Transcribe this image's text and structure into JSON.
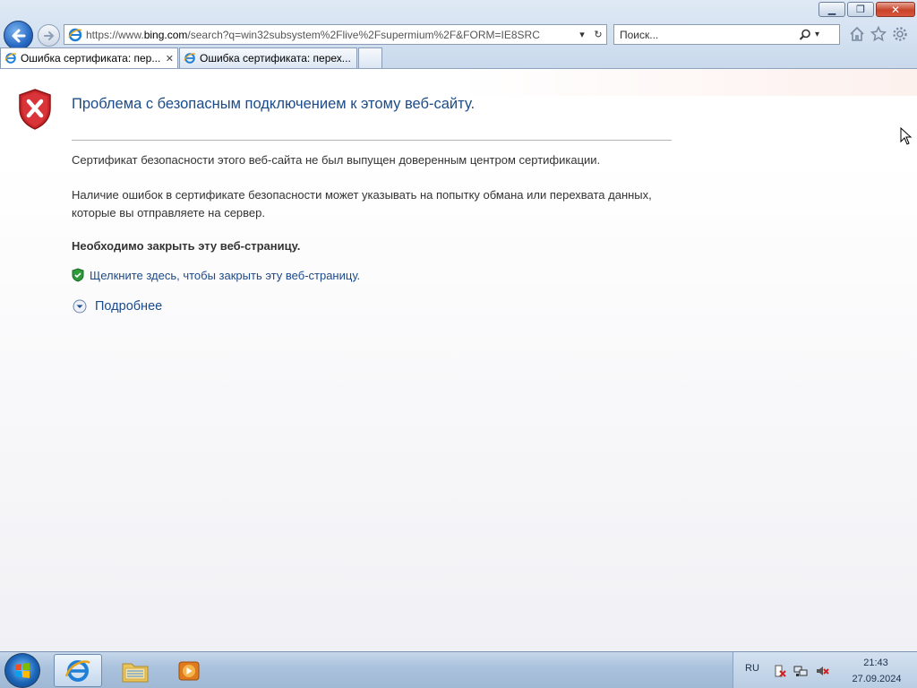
{
  "browser": {
    "address_url_prefix": "https://www.",
    "address_url_domain": "bing.com",
    "address_url_rest": "/search?q=win32subsystem%2Flive%2Fsupermium%2F&FORM=IE8SRC",
    "search_placeholder": "Поиск...",
    "tabs": [
      {
        "label": "Ошибка сертификата: пер...",
        "active": true
      },
      {
        "label": "Ошибка сертификата: перех...",
        "active": false
      }
    ],
    "icons": {
      "back": "back-arrow-icon",
      "forward": "forward-arrow-icon",
      "home": "home-icon",
      "favorites": "star-icon",
      "tools": "gear-icon"
    }
  },
  "page": {
    "title": "Проблема с безопасным подключением к этому веб-сайту.",
    "paragraph1": "Сертификат безопасности этого веб-сайта не был выпущен доверенным центром сертификации.",
    "paragraph2": "Наличие ошибок в сертификате безопасности может указывать на попытку обмана или перехвата данных, которые вы отправляете на сервер.",
    "recommendation": "Необходимо закрыть эту веб-страницу.",
    "close_link": "Щелкните здесь, чтобы закрыть эту веб-страницу.",
    "more_info": "Подробнее"
  },
  "taskbar": {
    "language": "RU",
    "time": "21:43",
    "date": "27.09.2024"
  },
  "colors": {
    "link": "#1c4b8a",
    "shield_red": "#c8262b",
    "taskbar": "#a9c1dc"
  }
}
